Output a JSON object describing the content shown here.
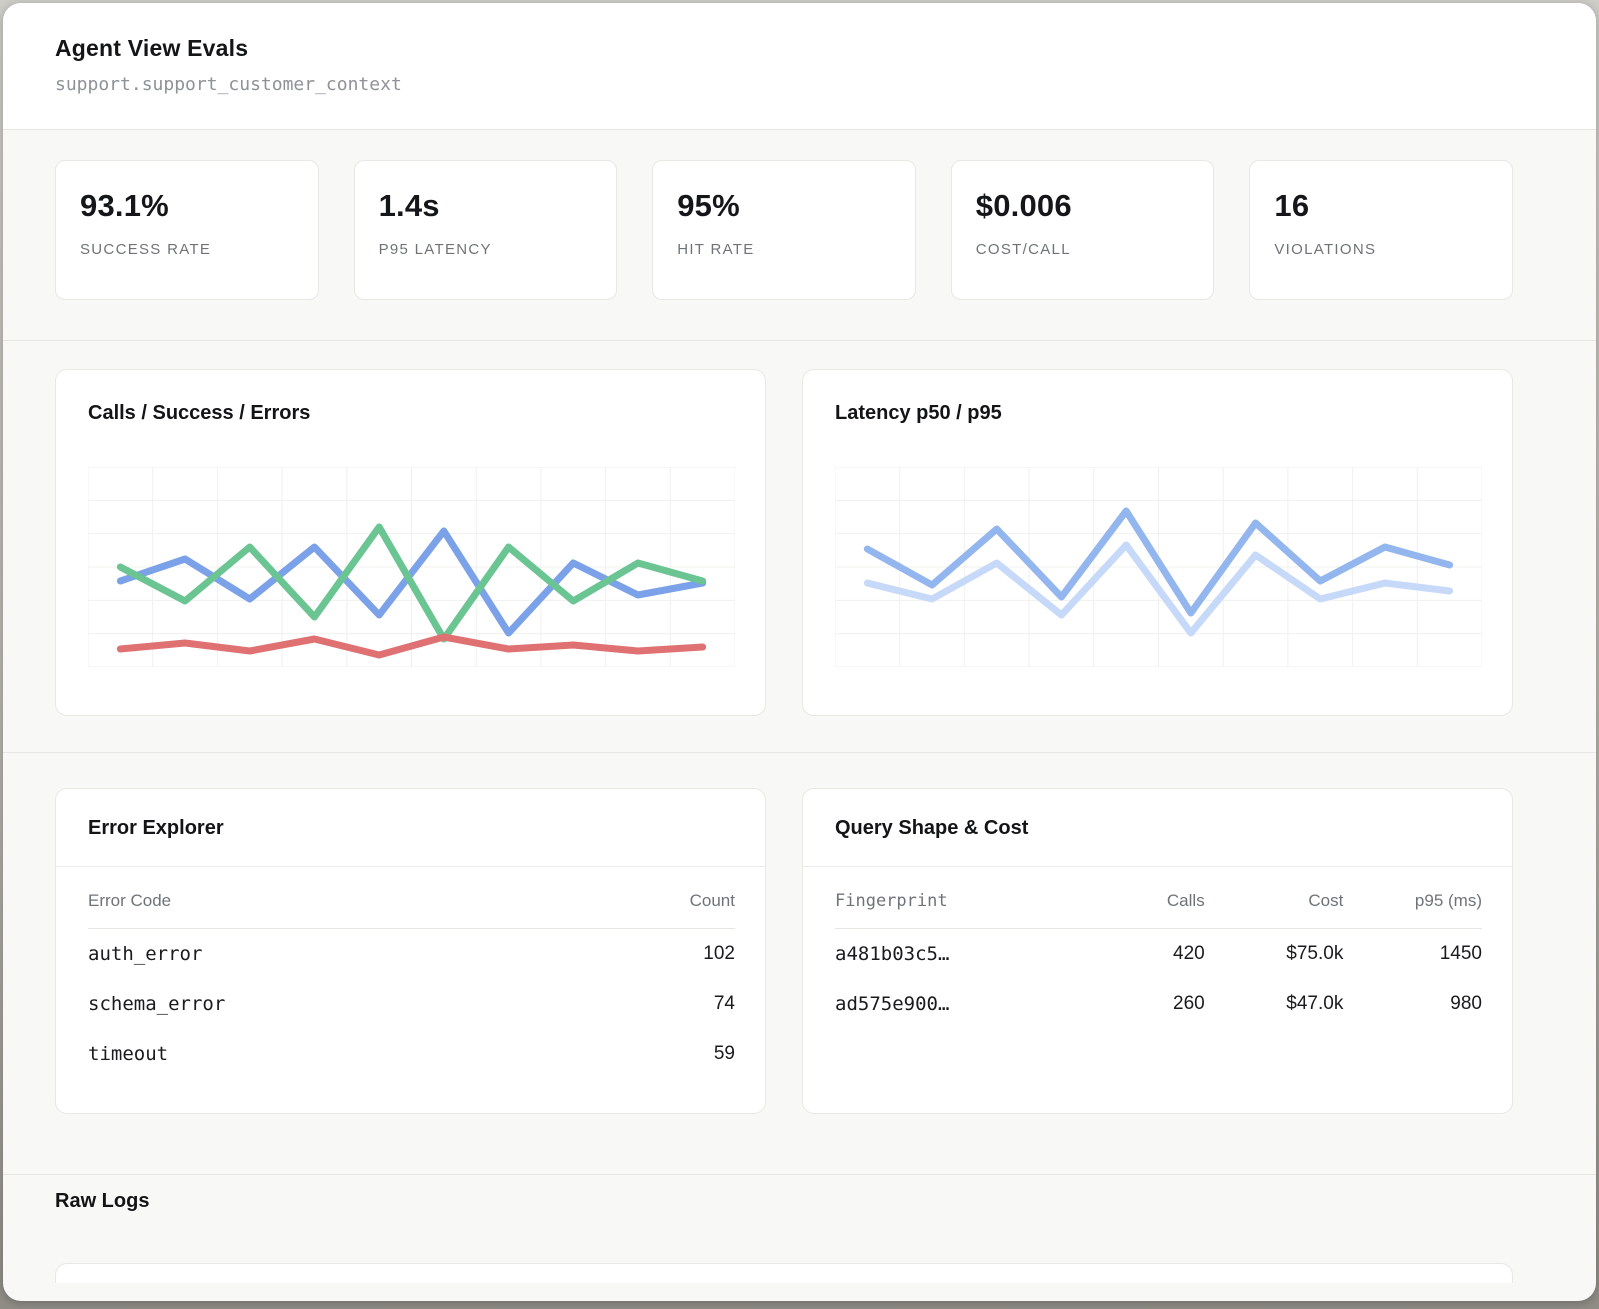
{
  "header": {
    "title": "Agent View Evals",
    "subtitle": "support.support_customer_context"
  },
  "kpis": [
    {
      "value": "93.1%",
      "label": "SUCCESS RATE"
    },
    {
      "value": "1.4s",
      "label": "P95 LATENCY"
    },
    {
      "value": "95%",
      "label": "HIT RATE"
    },
    {
      "value": "$0.006",
      "label": "COST/CALL"
    },
    {
      "value": "16",
      "label": "VIOLATIONS"
    }
  ],
  "chart_data": [
    {
      "type": "line",
      "title": "Calls / Success / Errors",
      "x": [
        1,
        2,
        3,
        4,
        5,
        6,
        7,
        8,
        9,
        10
      ],
      "series": [
        {
          "name": "calls",
          "color": "#7ba1e8",
          "values": [
            43,
            54,
            34,
            60,
            26,
            68,
            17,
            52,
            36,
            42
          ]
        },
        {
          "name": "success",
          "color": "#6ac592",
          "values": [
            50,
            33,
            60,
            25,
            70,
            14,
            60,
            33,
            52,
            43
          ]
        },
        {
          "name": "errors",
          "color": "#e07173",
          "values": [
            9,
            12,
            8,
            14,
            6,
            15,
            9,
            11,
            8,
            10
          ]
        }
      ],
      "ylim": [
        0,
        100
      ],
      "xlabel": "",
      "ylabel": "",
      "grid": true,
      "legend": "none",
      "tick_labels_visible": false
    },
    {
      "type": "line",
      "title": "Latency p50 / p95",
      "x": [
        1,
        2,
        3,
        4,
        5,
        6,
        7,
        8,
        9,
        10
      ],
      "series": [
        {
          "name": "p95",
          "color": "#93b6ee",
          "values": [
            59,
            41,
            69,
            35,
            78,
            27,
            72,
            43,
            60,
            51
          ]
        },
        {
          "name": "p50",
          "color": "#c6d9f8",
          "values": [
            42,
            34,
            52,
            26,
            61,
            17,
            56,
            34,
            42,
            38
          ]
        }
      ],
      "ylim": [
        0,
        100
      ],
      "xlabel": "",
      "ylabel": "",
      "grid": true,
      "legend": "none",
      "tick_labels_visible": false
    }
  ],
  "error_explorer": {
    "title": "Error Explorer",
    "columns": [
      "Error Code",
      "Count"
    ],
    "rows": [
      [
        "auth_error",
        "102"
      ],
      [
        "schema_error",
        "74"
      ],
      [
        "timeout",
        "59"
      ]
    ]
  },
  "query_shape": {
    "title": "Query Shape & Cost",
    "columns": [
      "Fingerprint",
      "Calls",
      "Cost",
      "p95 (ms)"
    ],
    "rows": [
      [
        "a481b03c5…",
        "420",
        "$75.0k",
        "1450"
      ],
      [
        "ad575e900…",
        "260",
        "$47.0k",
        "980"
      ]
    ]
  },
  "raw_logs": {
    "title": "Raw Logs"
  },
  "colors": {
    "section_bg": "#f8f8f6",
    "card_border": "#e8e8e5",
    "grid_line": "#f0f0ee",
    "calls_blue": "#7ba1e8",
    "success_green": "#6ac592",
    "errors_red": "#e07173",
    "p95_blue": "#93b6ee",
    "p50_blue": "#c6d9f8"
  }
}
